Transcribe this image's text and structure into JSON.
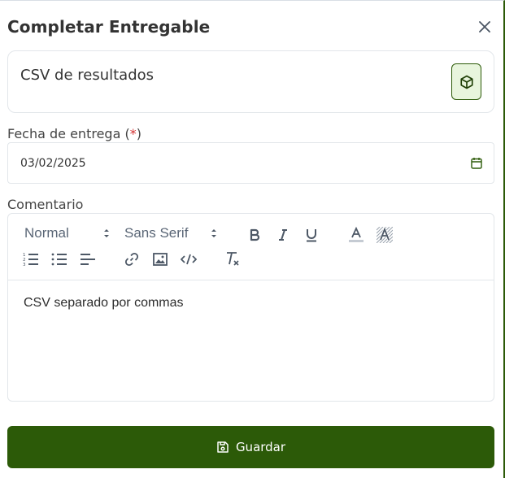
{
  "modal": {
    "title": "Completar Entregable",
    "close_icon": "close-icon"
  },
  "deliverable": {
    "name": "CSV de resultados",
    "icon": "cube-icon",
    "accent": "#2c5a08",
    "icon_bg": "#e8f5dd"
  },
  "date_field": {
    "label": "Fecha de entrega (",
    "required_mark": "*",
    "label_close": ")",
    "value": "03/02/2025",
    "icon": "calendar-icon"
  },
  "comment": {
    "label": "Comentario",
    "toolbar": {
      "header_select": "Normal",
      "font_select": "Sans Serif",
      "buttons": [
        "bold",
        "italic",
        "underline",
        "text-color",
        "background-color",
        "ordered-list",
        "bullet-list",
        "align",
        "link",
        "image",
        "code",
        "clear-format"
      ]
    },
    "content": "CSV separado por commas"
  },
  "save": {
    "label": "Guardar",
    "icon": "save-icon",
    "color": "#2c5a08"
  }
}
